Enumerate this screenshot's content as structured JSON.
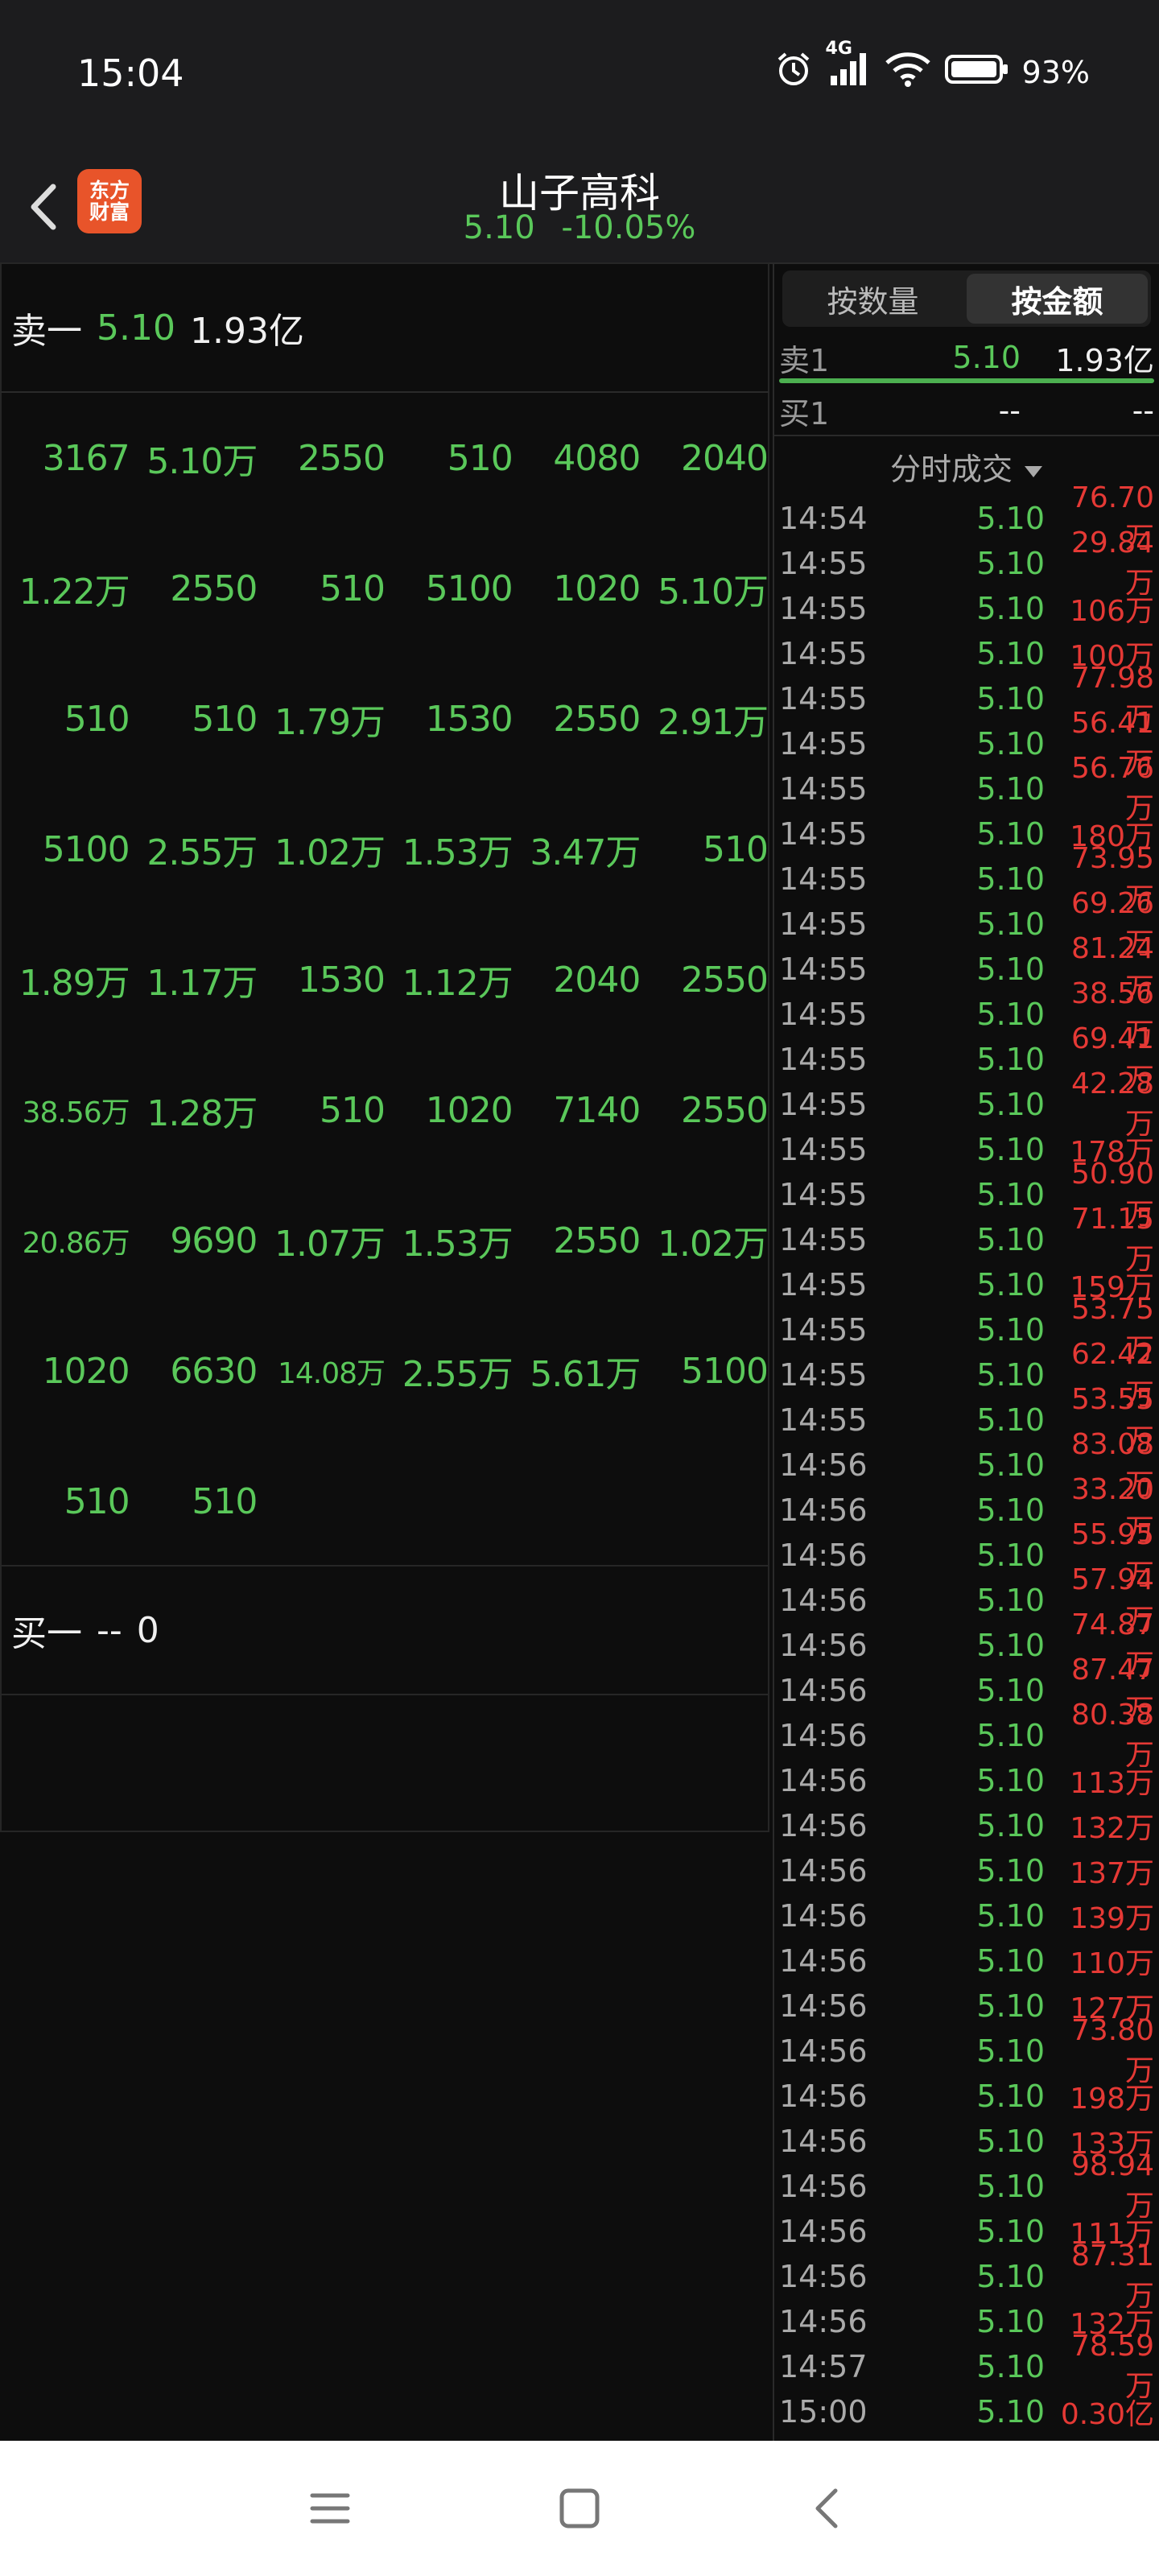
{
  "status": {
    "time": "15:04",
    "network": "4G",
    "battery": "93%"
  },
  "header": {
    "title": "山子高科",
    "price": "5.10",
    "change": "-10.05%",
    "logo_line1": "东方",
    "logo_line2": "财富"
  },
  "sell": {
    "label": "卖一",
    "price": "5.10",
    "volume": "1.93亿"
  },
  "grid": [
    [
      "3167",
      "5.10万",
      "2550",
      "510",
      "4080",
      "2040"
    ],
    [
      "1.22万",
      "2550",
      "510",
      "5100",
      "1020",
      "5.10万"
    ],
    [
      "510",
      "510",
      "1.79万",
      "1530",
      "2550",
      "2.91万"
    ],
    [
      "5100",
      "2.55万",
      "1.02万",
      "1.53万",
      "3.47万",
      "510"
    ],
    [
      "1.89万",
      "1.17万",
      "1530",
      "1.12万",
      "2040",
      "2550"
    ],
    [
      "38.56万",
      "1.28万",
      "510",
      "1020",
      "7140",
      "2550"
    ],
    [
      "20.86万",
      "9690",
      "1.07万",
      "1.53万",
      "2550",
      "1.02万"
    ],
    [
      "1020",
      "6630",
      "14.08万",
      "2.55万",
      "5.61万",
      "5100"
    ],
    [
      "510",
      "510",
      "",
      "",
      "",
      ""
    ]
  ],
  "buy": {
    "label": "买一",
    "price": "--",
    "volume": "0"
  },
  "right": {
    "toggle": [
      "按数量",
      "按金额"
    ],
    "sell1": {
      "label": "卖1",
      "price": "5.10",
      "value": "1.93亿"
    },
    "buy1": {
      "label": "买1",
      "price": "--",
      "value": "--"
    },
    "section": "分时成交",
    "ticks": [
      [
        "14:54",
        "5.10",
        "76.70万"
      ],
      [
        "14:55",
        "5.10",
        "29.84万"
      ],
      [
        "14:55",
        "5.10",
        "106万"
      ],
      [
        "14:55",
        "5.10",
        "100万"
      ],
      [
        "14:55",
        "5.10",
        "77.98万"
      ],
      [
        "14:55",
        "5.10",
        "56.41万"
      ],
      [
        "14:55",
        "5.10",
        "56.76万"
      ],
      [
        "14:55",
        "5.10",
        "180万"
      ],
      [
        "14:55",
        "5.10",
        "73.95万"
      ],
      [
        "14:55",
        "5.10",
        "69.26万"
      ],
      [
        "14:55",
        "5.10",
        "81.24万"
      ],
      [
        "14:55",
        "5.10",
        "38.56万"
      ],
      [
        "14:55",
        "5.10",
        "69.41万"
      ],
      [
        "14:55",
        "5.10",
        "42.28万"
      ],
      [
        "14:55",
        "5.10",
        "178万"
      ],
      [
        "14:55",
        "5.10",
        "50.90万"
      ],
      [
        "14:55",
        "5.10",
        "71.15万"
      ],
      [
        "14:55",
        "5.10",
        "159万"
      ],
      [
        "14:55",
        "5.10",
        "53.75万"
      ],
      [
        "14:55",
        "5.10",
        "62.42万"
      ],
      [
        "14:55",
        "5.10",
        "53.55万"
      ],
      [
        "14:56",
        "5.10",
        "83.08万"
      ],
      [
        "14:56",
        "5.10",
        "33.20万"
      ],
      [
        "14:56",
        "5.10",
        "55.95万"
      ],
      [
        "14:56",
        "5.10",
        "57.94万"
      ],
      [
        "14:56",
        "5.10",
        "74.87万"
      ],
      [
        "14:56",
        "5.10",
        "87.47万"
      ],
      [
        "14:56",
        "5.10",
        "80.38万"
      ],
      [
        "14:56",
        "5.10",
        "113万"
      ],
      [
        "14:56",
        "5.10",
        "132万"
      ],
      [
        "14:56",
        "5.10",
        "137万"
      ],
      [
        "14:56",
        "5.10",
        "139万"
      ],
      [
        "14:56",
        "5.10",
        "110万"
      ],
      [
        "14:56",
        "5.10",
        "127万"
      ],
      [
        "14:56",
        "5.10",
        "73.80万"
      ],
      [
        "14:56",
        "5.10",
        "198万"
      ],
      [
        "14:56",
        "5.10",
        "133万"
      ],
      [
        "14:56",
        "5.10",
        "98.94万"
      ],
      [
        "14:56",
        "5.10",
        "111万"
      ],
      [
        "14:56",
        "5.10",
        "87.31万"
      ],
      [
        "14:56",
        "5.10",
        "132万"
      ],
      [
        "14:57",
        "5.10",
        "78.59万"
      ],
      [
        "15:00",
        "5.10",
        "0.30亿"
      ]
    ]
  },
  "colors": {
    "up": "#e53935",
    "down": "#5ac85a",
    "bg": "#0d0d0d"
  }
}
